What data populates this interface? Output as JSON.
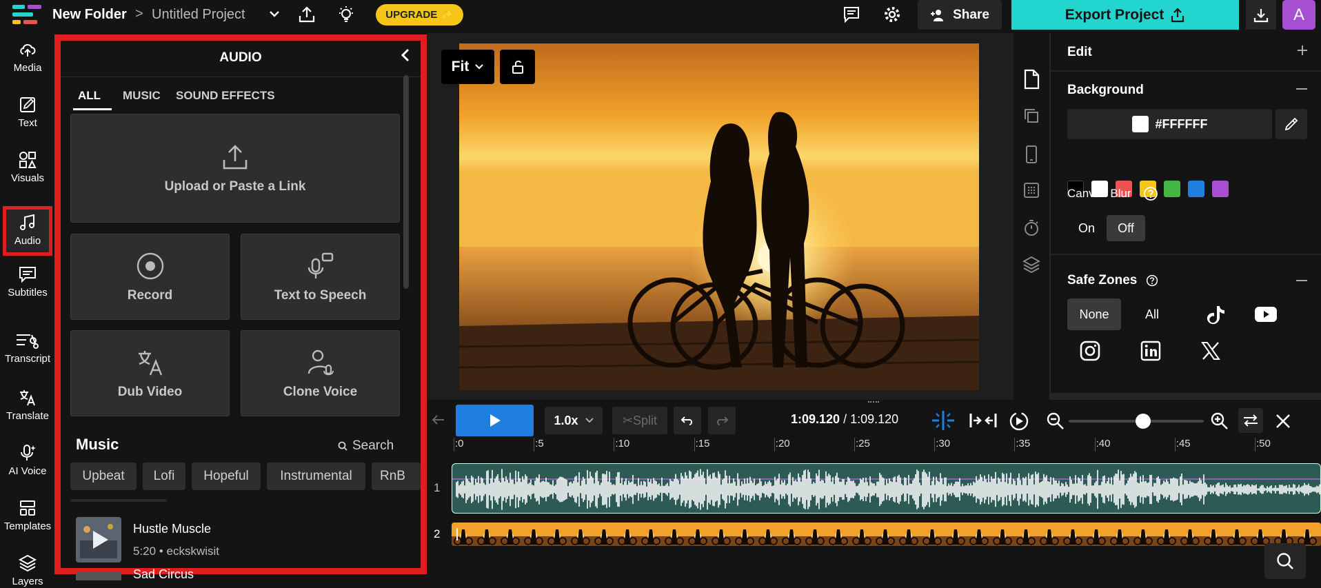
{
  "header": {
    "folder": "New Folder",
    "separator": ">",
    "project": "Untitled Project",
    "upgrade_label": "UPGRADE",
    "share_label": "Share",
    "export_label": "Export Project",
    "avatar_letter": "A"
  },
  "nav": {
    "items": [
      {
        "label": "Media",
        "icon": "upload-cloud-icon"
      },
      {
        "label": "Text",
        "icon": "edit-text-icon"
      },
      {
        "label": "Visuals",
        "icon": "shapes-icon"
      },
      {
        "label": "Audio",
        "icon": "music-note-icon"
      },
      {
        "label": "Subtitles",
        "icon": "subtitles-icon"
      },
      {
        "label": "Transcript",
        "icon": "transcript-icon"
      },
      {
        "label": "Translate",
        "icon": "translate-icon"
      },
      {
        "label": "AI Voice",
        "icon": "ai-voice-icon"
      },
      {
        "label": "Templates",
        "icon": "templates-icon"
      },
      {
        "label": "Layers",
        "icon": "layers-icon"
      }
    ]
  },
  "audio_panel": {
    "title": "AUDIO",
    "tabs": [
      "ALL",
      "MUSIC",
      "SOUND EFFECTS"
    ],
    "upload_label": "Upload or Paste a Link",
    "record_label": "Record",
    "tts_label": "Text to Speech",
    "dub_label": "Dub Video",
    "clone_label": "Clone Voice",
    "music_heading": "Music",
    "search_label": "Search",
    "genres": [
      "Upbeat",
      "Lofi",
      "Hopeful",
      "Instrumental",
      "RnB"
    ],
    "tracks": [
      {
        "title": "Hustle Muscle",
        "meta": "5:20 • eckskwisit"
      },
      {
        "title": "Sad Circus",
        "meta": ""
      }
    ]
  },
  "canvas": {
    "fit_label": "Fit"
  },
  "right_panel": {
    "edit_label": "Edit",
    "background_label": "Background",
    "bg_hex": "#FFFFFF",
    "palette": [
      "#000000",
      "#ffffff",
      "#ef5350",
      "#f5c518",
      "#43b643",
      "#1f7fe0",
      "#a64fd3"
    ],
    "canvas_blur_label": "Canvas Blur",
    "blur_on": "On",
    "blur_off": "Off",
    "safe_zones_label": "Safe Zones",
    "zone_none": "None",
    "zone_all": "All"
  },
  "timeline": {
    "speed": "1.0x",
    "split_label": "Split",
    "current_time": "1:09.120",
    "time_separator": " / ",
    "total_time": "1:09.120",
    "zoom_level": 0.55,
    "ruler": [
      ":0",
      ":5",
      ":10",
      ":15",
      ":20",
      ":25",
      ":30",
      ":35",
      ":40",
      ":45",
      ":50"
    ],
    "track_numbers": [
      "1",
      "2"
    ]
  },
  "colors": {
    "accent": "#23d5cf",
    "highlight": "#e01e1e",
    "play": "#1f7fe0",
    "upgrade": "#f5c518"
  }
}
